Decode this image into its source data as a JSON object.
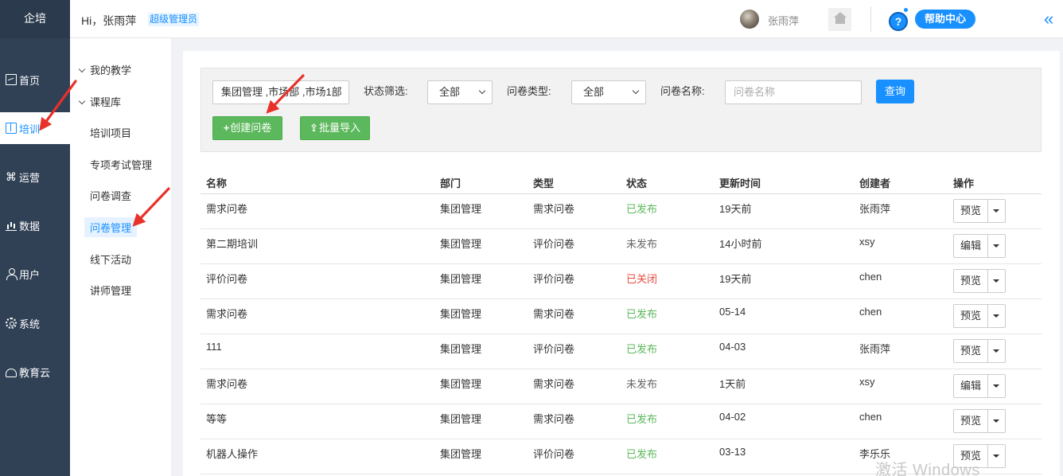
{
  "app": {
    "brand": "企培"
  },
  "sidebar": {
    "items": [
      {
        "label": "首页",
        "icon": "dashboard-icon",
        "active": false
      },
      {
        "label": "培训",
        "icon": "book-icon",
        "active": true
      },
      {
        "label": "运营",
        "icon": "command-icon",
        "active": false
      },
      {
        "label": "数据",
        "icon": "chart-bars-icon",
        "active": false
      },
      {
        "label": "用户",
        "icon": "user-icon",
        "active": false
      },
      {
        "label": "系统",
        "icon": "gear-icon",
        "active": false
      },
      {
        "label": "教育云",
        "icon": "cloud-icon",
        "active": false
      }
    ]
  },
  "topbar": {
    "greeting": "Hi，张雨萍",
    "role": "超级管理员",
    "username": "张雨萍",
    "help": "帮助中心",
    "help_mark": "?",
    "collapse_glyph": "«"
  },
  "submenu": {
    "group1": "我的教学",
    "group2": "课程库",
    "items": [
      {
        "label": "培训项目",
        "active": false
      },
      {
        "label": "专项考试管理",
        "active": false
      },
      {
        "label": "问卷调查",
        "active": false
      },
      {
        "label": "问卷管理",
        "active": true
      },
      {
        "label": "线下活动",
        "active": false
      },
      {
        "label": "讲师管理",
        "active": false
      }
    ]
  },
  "filters": {
    "dept_value": "集团管理 ,市场部 ,市场1部",
    "status_label": "状态筛选:",
    "status_value": "全部",
    "type_label": "问卷类型:",
    "type_value": "全部",
    "name_label": "问卷名称:",
    "name_placeholder": "问卷名称",
    "query_button": "查询",
    "create_button": "创建问卷",
    "create_glyph": "+",
    "import_button": "批量导入",
    "import_glyph": "⇪"
  },
  "table": {
    "headers": [
      "名称",
      "部门",
      "类型",
      "状态",
      "更新时间",
      "创建者",
      "操作"
    ],
    "rows": [
      {
        "name": "需求问卷",
        "dept": "集团管理",
        "type": "需求问卷",
        "status": "已发布",
        "status_kind": "published",
        "updated": "19天前",
        "creator": "张雨萍",
        "action": "预览"
      },
      {
        "name": "第二期培训",
        "dept": "集团管理",
        "type": "评价问卷",
        "status": "未发布",
        "status_kind": "unpublished",
        "updated": "14小时前",
        "creator": "xsy",
        "action": "编辑"
      },
      {
        "name": "评价问卷",
        "dept": "集团管理",
        "type": "评价问卷",
        "status": "已关闭",
        "status_kind": "closed",
        "updated": "19天前",
        "creator": "chen",
        "action": "预览"
      },
      {
        "name": "需求问卷",
        "dept": "集团管理",
        "type": "需求问卷",
        "status": "已发布",
        "status_kind": "published",
        "updated": "05-14",
        "creator": "chen",
        "action": "预览"
      },
      {
        "name": "111",
        "dept": "集团管理",
        "type": "评价问卷",
        "status": "已发布",
        "status_kind": "published",
        "updated": "04-03",
        "creator": "张雨萍",
        "action": "预览"
      },
      {
        "name": "需求问卷",
        "dept": "集团管理",
        "type": "需求问卷",
        "status": "未发布",
        "status_kind": "unpublished",
        "updated": "1天前",
        "creator": "xsy",
        "action": "编辑"
      },
      {
        "name": "等等",
        "dept": "集团管理",
        "type": "需求问卷",
        "status": "已发布",
        "status_kind": "published",
        "updated": "04-02",
        "creator": "chen",
        "action": "预览"
      },
      {
        "name": "机器人操作",
        "dept": "集团管理",
        "type": "评价问卷",
        "status": "已发布",
        "status_kind": "published",
        "updated": "03-13",
        "creator": "李乐乐",
        "action": "预览"
      }
    ]
  },
  "colors": {
    "sidebar_bg": "#304156",
    "accent": "#1890ff",
    "published": "#5cb85c",
    "closed": "#e64b3c",
    "annotation_arrow": "#e8312a"
  },
  "watermark": "激活 Windows"
}
